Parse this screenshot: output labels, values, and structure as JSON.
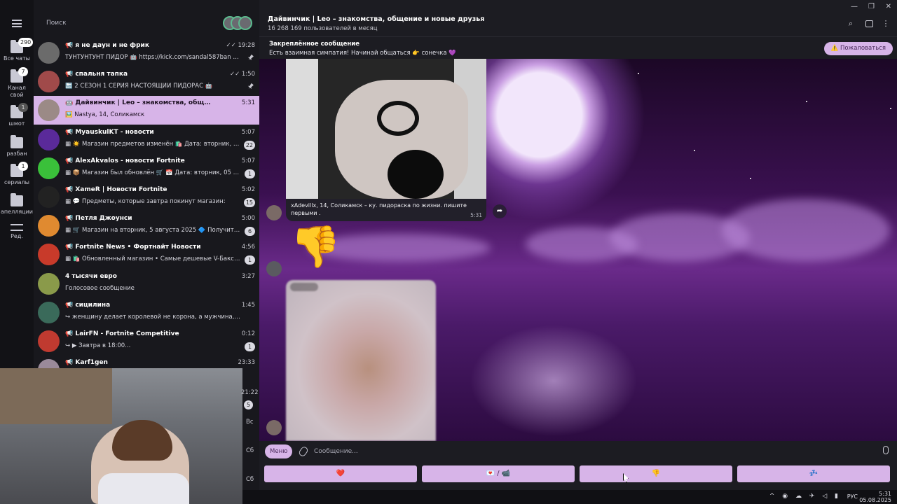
{
  "rail": {
    "items": [
      {
        "label": "Все чаты",
        "badge": "290"
      },
      {
        "label": "Канал свой",
        "badge": "7"
      },
      {
        "label": "шмот",
        "badge": "1"
      },
      {
        "label": "разбан",
        "badge": ""
      },
      {
        "label": "сериалы",
        "badge": "1"
      },
      {
        "label": "апелляции",
        "badge": ""
      },
      {
        "label": "Ред.",
        "badge": ""
      }
    ]
  },
  "list": {
    "search_placeholder": "Поиск",
    "chats": [
      {
        "name": "📢 я не даун и не фрик",
        "preview": "ТУНТУНТУНТ ПИДОР 🤖 https://kick.com/sandal587ban http...",
        "time": "✓✓ 19:28",
        "count": "",
        "pinned": true,
        "color": "#6b6b6b"
      },
      {
        "name": "📢 спальня тапка",
        "preview": "🔙 2 СЕЗОН 1 СЕРИЯ НАСТОЯЩИЙ ПИДОРАС 🤖",
        "time": "✓✓ 1:50",
        "count": "",
        "pinned": true,
        "color": "#a04a4a"
      },
      {
        "name": "🤖 Дайвинчик | Leo – знакомства, общение и новые др...",
        "preview": "🖼️ Nastya, 14, Соликамск",
        "time": "5:31",
        "count": "",
        "pinned": false,
        "color": "#9b8a86"
      },
      {
        "name": "📢 MyauskulKT - новости",
        "preview": "▦ ☀️ Магазин предметов изменён 🛍️ Дата: вторник, 05 ...",
        "time": "5:07",
        "count": "22",
        "pinned": false,
        "color": "#5a2a9a"
      },
      {
        "name": "📢 AlexAkvalos - новости Fortnite",
        "preview": "▦ 📦 Магазин был обновлён 🛒 📅 Дата: вторник, 05 авг...",
        "time": "5:07",
        "count": "1",
        "pinned": false,
        "color": "#3ac03a"
      },
      {
        "name": "📢 XameR | Новости Fortnite",
        "preview": "▦ 💬 Предметы, которые завтра покинут магазин:",
        "time": "5:02",
        "count": "15",
        "pinned": false,
        "color": "#222222"
      },
      {
        "name": "📢 Петля Джоунси",
        "preview": "▦ 🛒 Магазин на вторник, 5 августа 2025 🔷 Получить В-...",
        "time": "5:00",
        "count": "6",
        "pinned": false,
        "color": "#e08a30"
      },
      {
        "name": "📢 Fortnite News • Фортнайт Новости",
        "preview": "▦ 🛍️ Обновленный магазин • Самые дешевые V-Баксы - ...",
        "time": "4:56",
        "count": "1",
        "pinned": false,
        "color": "#c83a2a"
      },
      {
        "name": "4 тысячи евро",
        "preview": "Голосовое сообщение",
        "time": "3:27",
        "count": "",
        "pinned": false,
        "color": "#8a9a4a"
      },
      {
        "name": "📢 сицилина",
        "preview": "↪ женщину делает королевой не корона, а мужчина, который ...",
        "time": "1:45",
        "count": "",
        "pinned": false,
        "color": "#3a6a5a"
      },
      {
        "name": "📢 LairFN - Fortnite Competitive",
        "preview": "↪ ▶ Завтра в 18:00...",
        "time": "0:12",
        "count": "1",
        "pinned": false,
        "color": "#c03a30"
      },
      {
        "name": "📢 Karf1gen",
        "preview": "",
        "time": "23:33",
        "count": "",
        "pinned": false,
        "color": "#9a8a9a"
      }
    ],
    "day_labels": [
      "21:22",
      "Вс",
      "Сб",
      "Сб"
    ],
    "extra_badge": "5"
  },
  "header": {
    "title": "Дайвинчик | Leo – знакомства, общение и новые друзья",
    "subtitle": "16 268 169 пользователей в месяц"
  },
  "pinned": {
    "title": "Закреплённое сообщение",
    "text": "Есть взаимная симпатия! Начинай общаться 👉 сонечка 💜",
    "report_label": "⚠️ Пожаловаться"
  },
  "messages": {
    "caption": "xAdevillx, 14, Соликамск – ку. пидораска по жизни. пишите первыми .",
    "caption_time": "5:31",
    "sticker": "👎"
  },
  "composer": {
    "menu_label": "Меню",
    "placeholder": "Сообщение..."
  },
  "keyboard": [
    "❤️",
    "💌 / 📹",
    "👎",
    "💤"
  ],
  "taskbar": {
    "lang": "РУС",
    "time": "5:31",
    "date": "05.08.2025"
  }
}
